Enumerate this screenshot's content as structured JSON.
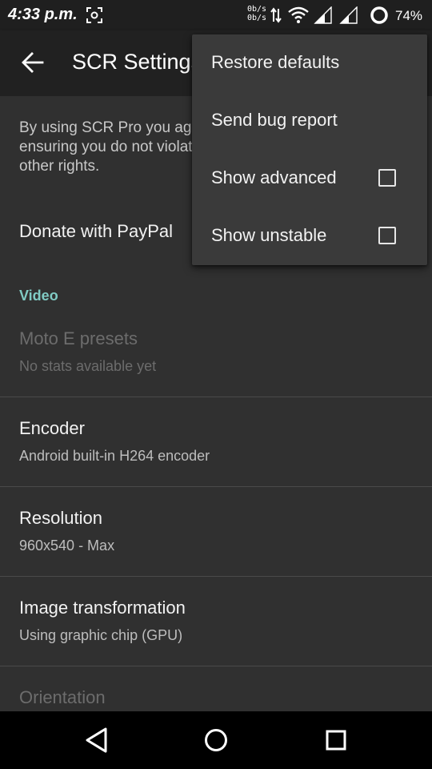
{
  "status_bar": {
    "time": "4:33 p.m.",
    "net_speed_up": "0b/s",
    "net_speed_down": "0b/s",
    "battery": "74%",
    "icons": [
      "screenshot-icon",
      "data-updown-icon",
      "wifi-icon",
      "signal-icon",
      "signal-icon",
      "battery-ring-icon"
    ]
  },
  "toolbar": {
    "back_icon": "arrow-back-icon",
    "title": "SCR Settings"
  },
  "intro": {
    "text": "By using SCR Pro you agree that you are responsible for ensuring you do not violate any third party copyright or other rights."
  },
  "donate": {
    "label": "Donate with PayPal"
  },
  "section": {
    "video_header": "Video"
  },
  "preferences": [
    {
      "title": "Moto E presets",
      "summary": "No stats available yet",
      "enabled": false
    },
    {
      "title": "Encoder",
      "summary": "Android built-in H264 encoder",
      "enabled": true
    },
    {
      "title": "Resolution",
      "summary": "960x540 - Max",
      "enabled": true
    },
    {
      "title": "Image transformation",
      "summary": "Using graphic chip (GPU)",
      "enabled": true
    },
    {
      "title": "Orientation",
      "summary": "",
      "enabled": false
    }
  ],
  "menu": {
    "items": [
      {
        "label": "Restore defaults"
      },
      {
        "label": "Send bug report"
      },
      {
        "label": "Show advanced",
        "checked": false
      },
      {
        "label": "Show unstable",
        "checked": false
      }
    ]
  },
  "nav_bar": {
    "icons": [
      "nav-back-icon",
      "nav-home-icon",
      "nav-recents-icon"
    ]
  },
  "colors": {
    "accent": "#80cbc4",
    "background": "#303030",
    "toolbar": "#212121",
    "menu": "#3a3a3a"
  }
}
